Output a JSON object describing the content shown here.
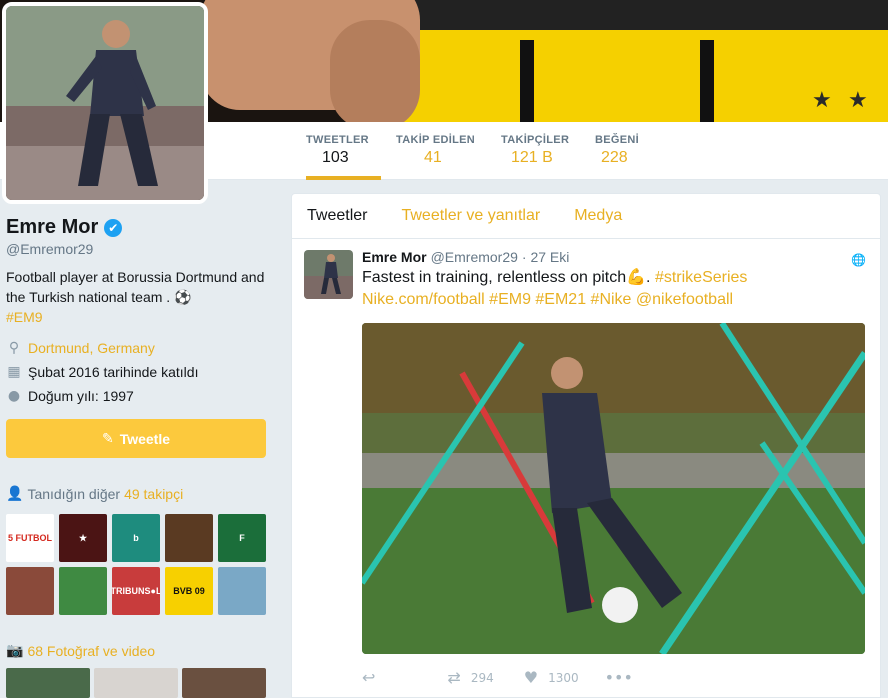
{
  "nav": {
    "items": [
      {
        "label": "TWEETLER",
        "value": "103"
      },
      {
        "label": "TAKİP EDİLEN",
        "value": "41"
      },
      {
        "label": "TAKİPÇİLER",
        "value": "121 B"
      },
      {
        "label": "BEĞENİ",
        "value": "228"
      }
    ]
  },
  "profile": {
    "name": "Emre Mor",
    "verified_icon": "✔",
    "handle": "@Emremor29",
    "bio_text": "Football player at Borussia Dortmund and the Turkish national team . ⚽",
    "bio_tag": "#EM9",
    "location_icon": "location-pin-icon",
    "location": "Dortmund, Germany",
    "joined_icon": "calendar-icon",
    "joined": "Şubat 2016 tarihinde katıldı",
    "birth_icon": "balloon-icon",
    "birth": "Doğum yılı: 1997"
  },
  "compose": {
    "label": "Tweetle",
    "icon": "✎"
  },
  "followers_you_know": {
    "prefix": "Tanıdığın diğer",
    "link": "49 takipçi",
    "tiles": [
      {
        "text": "5 FUTBOL",
        "color": "#ffffff",
        "fg": "#d4291f"
      },
      {
        "text": "★",
        "color": "#4b1414",
        "fg": "#ffffff"
      },
      {
        "text": "b",
        "color": "#1e8c7e",
        "fg": "#ffffff"
      },
      {
        "text": "",
        "color": "#5a3a22",
        "fg": "#ffffff"
      },
      {
        "text": "F",
        "color": "#1b6e3a",
        "fg": "#ffffff"
      },
      {
        "text": "",
        "color": "#8a4a3a",
        "fg": "#ffffff"
      },
      {
        "text": "",
        "color": "#3f8a42",
        "fg": "#ffffff"
      },
      {
        "text": "TRIBUNS●L",
        "color": "#c83c3c",
        "fg": "#ffffff"
      },
      {
        "text": "BVB 09",
        "color": "#f7d000",
        "fg": "#111111"
      },
      {
        "text": "",
        "color": "#7aa8c6",
        "fg": "#ffffff"
      }
    ]
  },
  "photos": {
    "label": "68 Fotoğraf ve video"
  },
  "timeline": {
    "tabs": [
      "Tweetler",
      "Tweetler ve yanıtlar",
      "Medya"
    ],
    "tweet": {
      "name": "Emre Mor",
      "handle": "@Emremor29",
      "time": "· 27 Eki",
      "text_plain": "Fastest in training, relentless on pitch💪. ",
      "tag1": "#strikeSeries",
      "line2": "Nike.com/football #EM9 #EM21 #Nike @nikefootball",
      "reply_icon": "↩",
      "retweet_icon": "⇄",
      "retweets": "294",
      "like_icon": "♥",
      "likes": "1300",
      "more_icon": "•••",
      "globe_icon": "🌐"
    }
  },
  "colors": {
    "accent": "#e8b023",
    "tweet_button": "#fcc93d",
    "muted": "#657786"
  }
}
